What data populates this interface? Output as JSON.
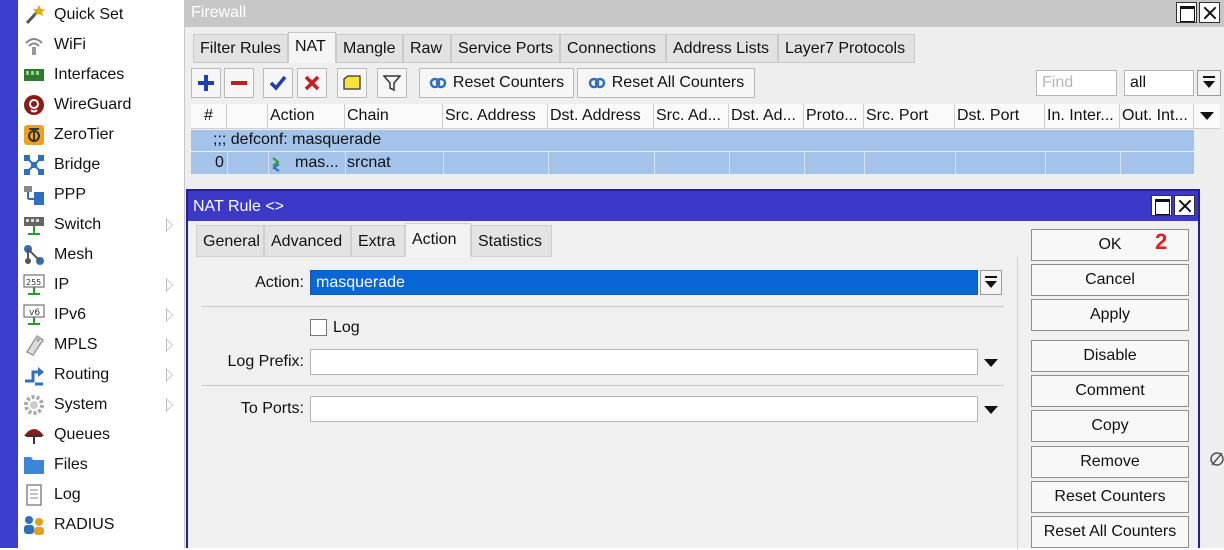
{
  "sidebar": {
    "items": [
      {
        "label": "Quick Set",
        "icon": "magic-wand-icon",
        "submenu": false
      },
      {
        "label": "WiFi",
        "icon": "wifi-icon",
        "submenu": false
      },
      {
        "label": "Interfaces",
        "icon": "interfaces-icon",
        "submenu": false
      },
      {
        "label": "WireGuard",
        "icon": "wireguard-icon",
        "submenu": false
      },
      {
        "label": "ZeroTier",
        "icon": "zerotier-icon",
        "submenu": false
      },
      {
        "label": "Bridge",
        "icon": "bridge-icon",
        "submenu": false
      },
      {
        "label": "PPP",
        "icon": "ppp-icon",
        "submenu": false
      },
      {
        "label": "Switch",
        "icon": "switch-icon",
        "submenu": true
      },
      {
        "label": "Mesh",
        "icon": "mesh-icon",
        "submenu": false
      },
      {
        "label": "IP",
        "icon": "ip-icon",
        "submenu": true
      },
      {
        "label": "IPv6",
        "icon": "ipv6-icon",
        "submenu": true
      },
      {
        "label": "MPLS",
        "icon": "mpls-icon",
        "submenu": true
      },
      {
        "label": "Routing",
        "icon": "routing-icon",
        "submenu": true
      },
      {
        "label": "System",
        "icon": "system-gear-icon",
        "submenu": true
      },
      {
        "label": "Queues",
        "icon": "queues-icon",
        "submenu": false
      },
      {
        "label": "Files",
        "icon": "folder-icon",
        "submenu": false
      },
      {
        "label": "Log",
        "icon": "log-icon",
        "submenu": false
      },
      {
        "label": "RADIUS",
        "icon": "radius-icon",
        "submenu": false
      }
    ],
    "strip_color": "#3b3fd0"
  },
  "firewall": {
    "title": "Firewall",
    "tabs": [
      "Filter Rules",
      "NAT",
      "Mangle",
      "Raw",
      "Service Ports",
      "Connections",
      "Address Lists",
      "Layer7 Protocols"
    ],
    "active_tab": "NAT",
    "toolbar": {
      "reset_counters": "Reset Counters",
      "reset_all_counters": "Reset All Counters",
      "find_placeholder": "Find",
      "filter_value": "all"
    },
    "columns": [
      "#",
      "",
      "Action",
      "Chain",
      "Src. Address",
      "Dst. Address",
      "Src. Ad...",
      "Dst. Ad...",
      "Proto...",
      "Src. Port",
      "Dst. Port",
      "In. Inter...",
      "Out. Int..."
    ],
    "comment_row": ";;; defconf: masquerade",
    "rows": [
      {
        "num": "0",
        "action": "mas...",
        "chain": "srcnat"
      }
    ],
    "selected_color": "#a4c3ea"
  },
  "dialog": {
    "title": "NAT Rule <>",
    "tabs": [
      "General",
      "Advanced",
      "Extra",
      "Action",
      "Statistics"
    ],
    "active_tab": "Action",
    "fields": {
      "action_label": "Action:",
      "action_value": "masquerade",
      "log_label": "Log",
      "log_checked": false,
      "log_prefix_label": "Log Prefix:",
      "log_prefix_value": "",
      "to_ports_label": "To Ports:",
      "to_ports_value": ""
    },
    "buttons": [
      "OK",
      "Cancel",
      "Apply",
      "Disable",
      "Comment",
      "Copy",
      "Remove",
      "Reset Counters",
      "Reset All Counters"
    ],
    "annotation": "2",
    "title_color": "#3c39c8",
    "annotation_color": "#e0201b"
  }
}
